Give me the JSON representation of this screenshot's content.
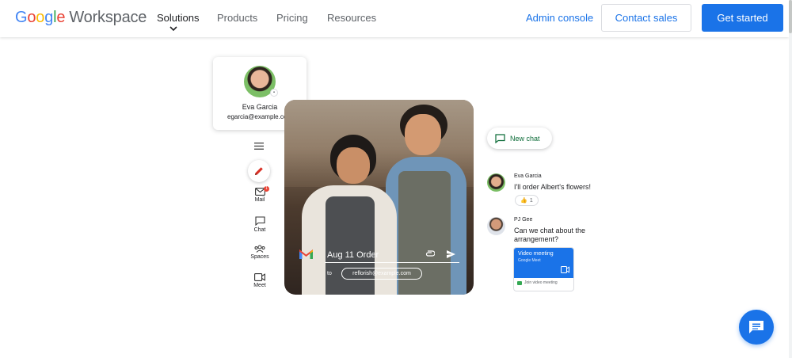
{
  "header": {
    "brand": {
      "google": [
        "G",
        "o",
        "o",
        "g",
        "l",
        "e"
      ],
      "product": "Workspace"
    },
    "nav": [
      "Solutions",
      "Products",
      "Pricing",
      "Resources"
    ],
    "admin_console": "Admin console",
    "contact_sales": "Contact sales",
    "get_started": "Get started"
  },
  "profile": {
    "name": "Eva Garcia",
    "email": "egarcia@example.com"
  },
  "rail": {
    "mail": "Mail",
    "mail_badge": "1",
    "chat": "Chat",
    "spaces": "Spaces",
    "meet": "Meet"
  },
  "compose": {
    "subject": "Aug 11 Order",
    "to_label": "to",
    "recipient": "reflorish@example.com"
  },
  "chat": {
    "new_chat": "New chat",
    "messages": [
      {
        "sender": "Eva Garcia",
        "text": "I'll order Albert's flowers!",
        "reaction": "👍",
        "reaction_count": "1"
      },
      {
        "sender": "PJ Gee",
        "text": "Can we chat about the arrangement?"
      }
    ],
    "meet_card": {
      "title": "Video meeting",
      "subtitle": "Google Meet",
      "join": "Join video meeting"
    }
  },
  "colors": {
    "primary": "#1a73e8",
    "chat_green": "#0b6b37",
    "badge_red": "#ea4335"
  },
  "icons": [
    "menu-icon",
    "pencil-icon",
    "mail-icon",
    "chat-icon",
    "spaces-icon",
    "meet-icon",
    "gmail-logo",
    "attach-icon",
    "send-icon",
    "new-chat-icon",
    "video-icon",
    "chat-fab-icon",
    "chevron-down-icon"
  ]
}
